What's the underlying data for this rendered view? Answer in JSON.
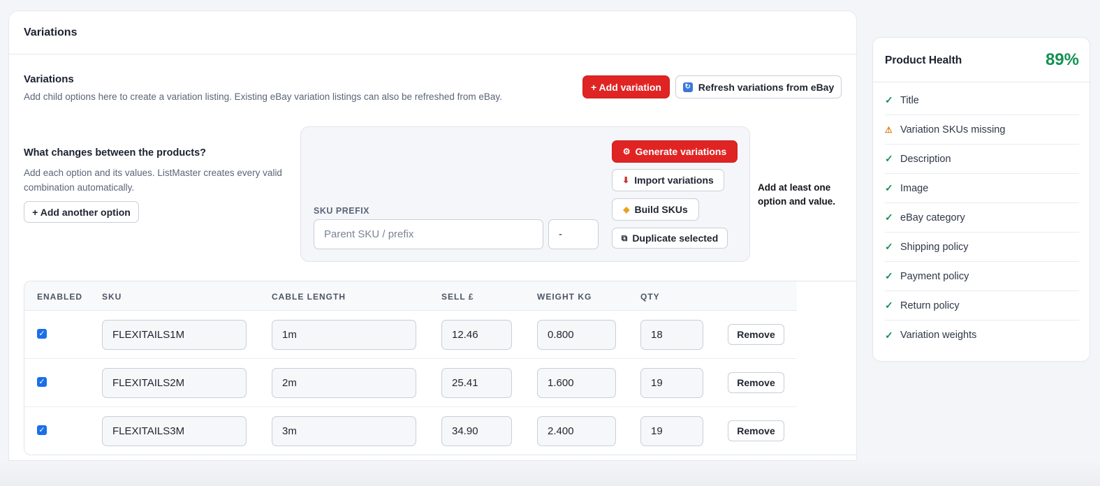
{
  "main": {
    "card_title": "Variations",
    "section_title": "Variations",
    "section_desc": "Add child options here to create a variation listing. Existing eBay variation listings can also be refreshed from eBay.",
    "add_variation_label": "+ Add variation",
    "refresh_label": "Refresh variations from eBay",
    "options_title": "What changes between the products?",
    "options_desc": "Add each option and its values. ListMaster creates every valid combination automatically.",
    "add_option_label": "+ Add another option",
    "sku_prefix_label": "SKU PREFIX",
    "sku_prefix_placeholder": "Parent SKU / prefix",
    "separator_value": "-",
    "generate_label": "Generate variations",
    "import_label": "Import variations",
    "build_label": "Build SKUs",
    "duplicate_label": "Duplicate selected",
    "hint": "Add at least one option and value."
  },
  "table": {
    "columns": [
      "ENABLED",
      "SKU",
      "CABLE LENGTH",
      "SELL £",
      "WEIGHT KG",
      "QTY"
    ],
    "remove_label": "Remove",
    "rows": [
      {
        "enabled": true,
        "sku": "FLEXITAILS1M",
        "cable_length": "1m",
        "sell": "12.46",
        "weight": "0.800",
        "qty": "18"
      },
      {
        "enabled": true,
        "sku": "FLEXITAILS2M",
        "cable_length": "2m",
        "sell": "25.41",
        "weight": "1.600",
        "qty": "19"
      },
      {
        "enabled": true,
        "sku": "FLEXITAILS3M",
        "cable_length": "3m",
        "sell": "34.90",
        "weight": "2.400",
        "qty": "19"
      }
    ]
  },
  "health": {
    "title": "Product Health",
    "score": "89%",
    "items": [
      {
        "label": "Title",
        "status": "ok"
      },
      {
        "label": "Variation SKUs missing",
        "status": "warning"
      },
      {
        "label": "Description",
        "status": "ok"
      },
      {
        "label": "Image",
        "status": "ok"
      },
      {
        "label": "eBay category",
        "status": "ok"
      },
      {
        "label": "Shipping policy",
        "status": "ok"
      },
      {
        "label": "Payment policy",
        "status": "ok"
      },
      {
        "label": "Return policy",
        "status": "ok"
      },
      {
        "label": "Variation weights",
        "status": "ok"
      }
    ]
  },
  "colors": {
    "accent_red": "#e02424",
    "ok_green": "#149154",
    "warn_orange": "#e27d16",
    "checkbox_blue": "#1a6fe8"
  }
}
